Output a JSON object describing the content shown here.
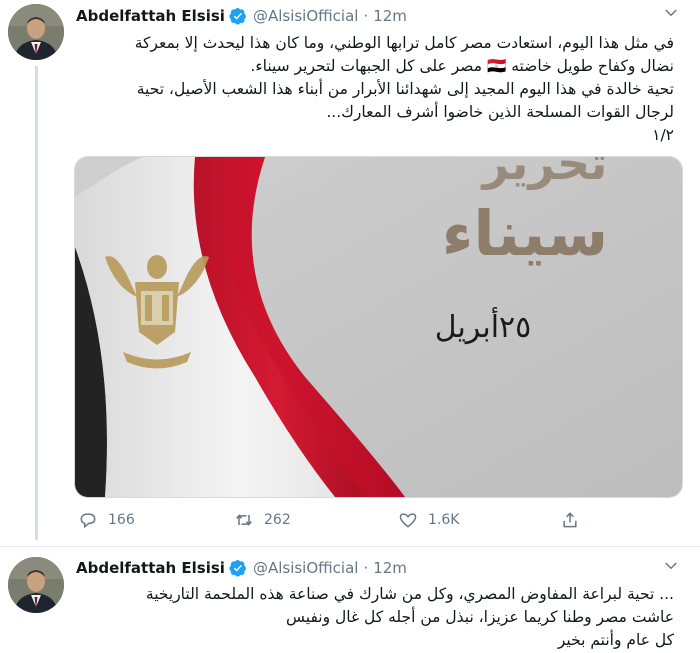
{
  "tweets": [
    {
      "author_name": "Abdelfattah Elsisi",
      "handle": "@AlsisiOfficial",
      "separator": "·",
      "time": "12m",
      "text_lines": [
        "في مثل هذا اليوم، استعادت مصر كامل ترابها الوطني، وما كان هذا ليحدث إلا بمعركة",
        "نضال وكفاح طويل خاضته 🇪🇬 مصر على كل الجبهات لتحرير سيناء.",
        "تحية خالدة في هذا اليوم المجيد إلى شهدائنا الأبرار من أبناء هذا الشعب الأصيل، تحية",
        "لرجال القوات المسلحة الذين خاضوا أشرف المعارك...",
        "١/٢"
      ],
      "image": {
        "headline_top": "تحرير",
        "headline": "سيناء",
        "date": "٢٥أبريل"
      },
      "actions": {
        "reply_icon": "reply-icon",
        "reply_count": "166",
        "retweet_icon": "retweet-icon",
        "retweet_count": "262",
        "like_icon": "heart-icon",
        "like_count": "1.6K",
        "share_icon": "share-icon"
      }
    },
    {
      "author_name": "Abdelfattah Elsisi",
      "handle": "@AlsisiOfficial",
      "separator": "·",
      "time": "12m",
      "text_lines": [
        "... تحية لبراعة المفاوض المصري، وكل من شارك في صناعة هذه الملحمة التاريخية",
        "عاشت مصر وطنا كريما عزيزا، نبذل من أجله كل غال ونفيس",
        "كل عام وأنتم بخير"
      ]
    }
  ],
  "colors": {
    "verified_blue": "#1da1f2",
    "meta_gray": "#657786",
    "flag_red": "#c8102e",
    "flag_black": "#222222",
    "eagle_gold": "#b89a5a"
  }
}
